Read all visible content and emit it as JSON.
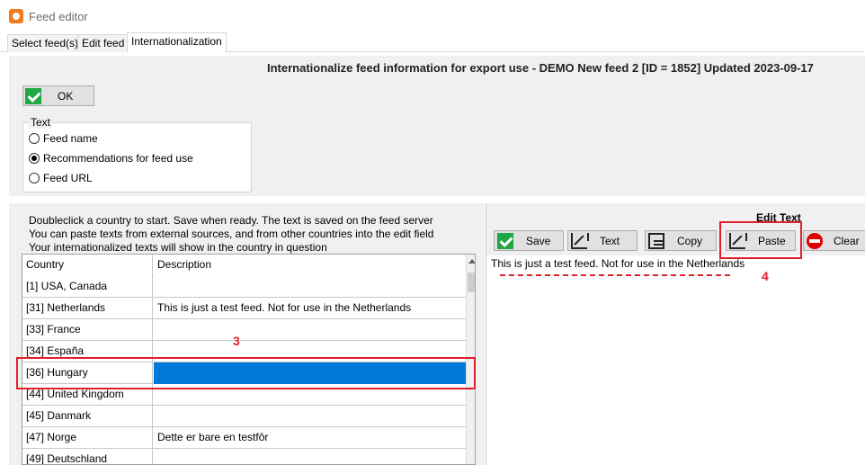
{
  "window": {
    "title": "Feed editor"
  },
  "tabs": [
    {
      "label": "Select feed(s)"
    },
    {
      "label": "Edit feed"
    },
    {
      "label": "Internationalization"
    }
  ],
  "header": {
    "title": "Internationalize feed information for export use - DEMO New feed 2 [ID = 1852] Updated 2023-09-17",
    "ok_label": "OK"
  },
  "text_group": {
    "legend": "Text",
    "options": [
      {
        "label": "Feed name",
        "selected": false
      },
      {
        "label": "Recommendations for feed use",
        "selected": true
      },
      {
        "label": "Feed URL",
        "selected": false
      }
    ]
  },
  "instructions": [
    "Doubleclick a country to start. Save when ready. The text is saved on the feed server",
    "You can paste texts from external sources, and from other countries into the edit field",
    "Your internationalized texts will show in the country in question"
  ],
  "grid": {
    "columns": [
      "Country",
      "Description"
    ],
    "rows": [
      {
        "country": "[1] USA, Canada",
        "description": ""
      },
      {
        "country": "[31] Netherlands",
        "description": "This is just a test feed. Not for use in the Netherlands"
      },
      {
        "country": "[33] France",
        "description": ""
      },
      {
        "country": "[34] España",
        "description": ""
      },
      {
        "country": "[36] Hungary",
        "description": "",
        "selected": true
      },
      {
        "country": "[44] United Kingdom",
        "description": ""
      },
      {
        "country": "[45] Danmark",
        "description": ""
      },
      {
        "country": "[47] Norge",
        "description": "Dette er bare en testfôr"
      },
      {
        "country": "[49] Deutschland",
        "description": ""
      }
    ]
  },
  "edit_panel": {
    "title": "Edit Text",
    "buttons": {
      "save": "Save",
      "text": "Text",
      "copy": "Copy",
      "paste": "Paste",
      "clear": "Clear"
    },
    "content": "This is just a test feed. Not for use in the Netherlands"
  },
  "annotations": {
    "grid_marker": "3",
    "paste_marker": "4",
    "color": "#e0202a"
  },
  "colors": {
    "selection": "#0078d7",
    "ok_green": "#20a845",
    "clear_red": "#e00000",
    "app_icon": "#f07c1e"
  }
}
